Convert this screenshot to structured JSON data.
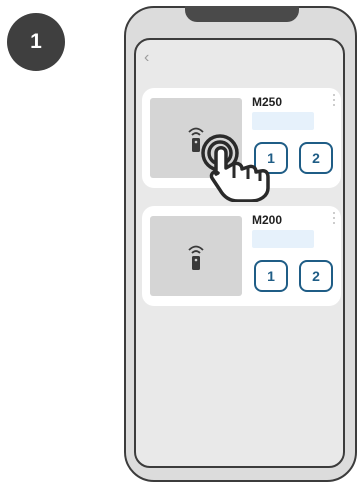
{
  "step": {
    "number": "1"
  },
  "screen": {
    "back_icon": "chevron-left-icon",
    "devices": [
      {
        "name": "M250",
        "buttons": [
          "1",
          "2"
        ]
      },
      {
        "name": "M200",
        "buttons": [
          "1",
          "2"
        ]
      }
    ]
  },
  "colors": {
    "accent": "#1f5d86",
    "status_field": "#e6f1fb",
    "badge": "#3f3f3f"
  }
}
